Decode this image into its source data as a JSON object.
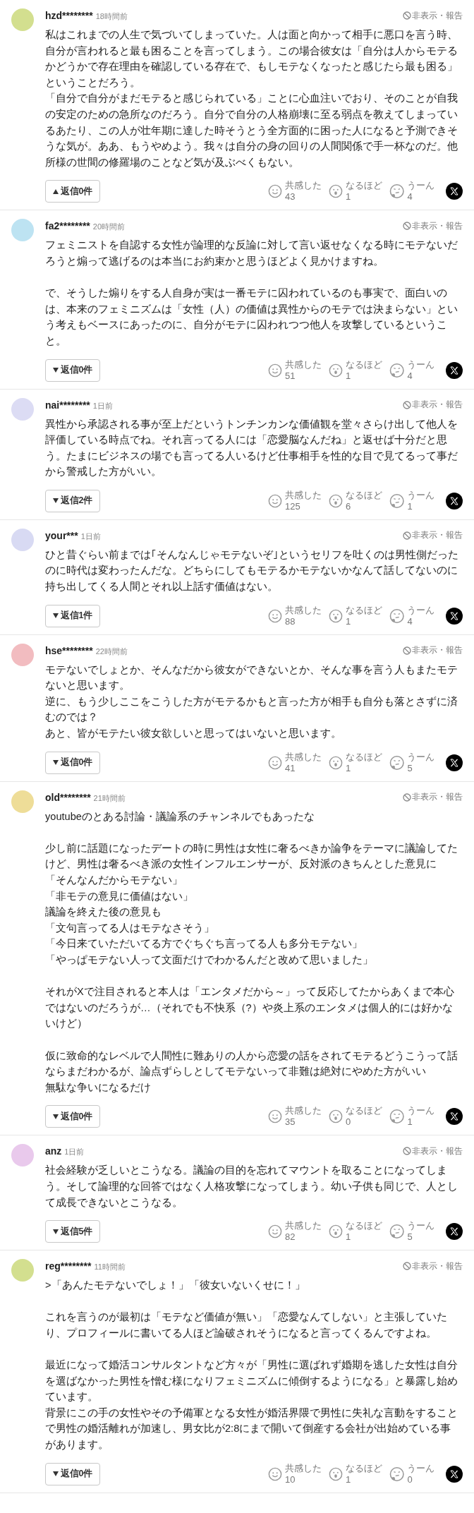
{
  "comments": [
    {
      "user": "hzd********",
      "time": "18時間前",
      "color": "#d3df8f",
      "hide_link": "非表示・報告",
      "paragraphs": [
        {
          "lines": [
            "私はこれまでの人生で気づいてしまっていた。人は面と向かって相手に悪口を言う時、自分が言われると最も困ることを言ってしまう。この場合彼女は「自分は人からモテるかどうかで存在理由を確認している存在で、もしモテなくなったと感じたら最も困る」ということだろう。",
            "「自分で自分がまだモテると感じられている」ことに心血注いでおり、そのことが自我の安定のための急所なのだろう。自分で自分の人格崩壊に至る弱点を教えてしまっているあたり、この人が壮年期に達した時そうとう全方面的に困った人になると予測できそうな気が。ああ、もうやめよう。我々は自分の身の回りの人間関係で手一杯なのだ。他所様の世間の修羅場のことなど気が及ぶべくもない。"
          ]
        }
      ],
      "replies": {
        "label": "返信0件",
        "expanded": true
      },
      "reactions": [
        {
          "kind": "empathy",
          "label": "共感した",
          "count": "43"
        },
        {
          "kind": "insight",
          "label": "なるほど",
          "count": "1"
        },
        {
          "kind": "hmm",
          "label": "うーん",
          "count": "4"
        }
      ]
    },
    {
      "user": "fa2********",
      "time": "20時間前",
      "color": "#bde3f2",
      "hide_link": "非表示・報告",
      "paragraphs": [
        {
          "lines": [
            "フェミニストを自認する女性が論理的な反論に対して言い返せなくなる時にモテないだろうと煽って逃げるのは本当にお約束かと思うほどよく見かけますね。"
          ]
        },
        {
          "lines": [
            "で、そうした煽りをする人自身が実は一番モテに囚われているのも事実で、面白いのは、本来のフェミニズムは「女性（人）の価値は異性からのモテでは決まらない」という考えもベースにあったのに、自分がモテに囚われつつ他人を攻撃しているということ。"
          ]
        }
      ],
      "replies": {
        "label": "返信0件",
        "expanded": false
      },
      "reactions": [
        {
          "kind": "empathy",
          "label": "共感した",
          "count": "51"
        },
        {
          "kind": "insight",
          "label": "なるほど",
          "count": "1"
        },
        {
          "kind": "hmm",
          "label": "うーん",
          "count": "4"
        }
      ]
    },
    {
      "user": "nai********",
      "time": "1日前",
      "color": "#dcdcf4",
      "hide_link": "非表示・報告",
      "paragraphs": [
        {
          "lines": [
            "異性から承認される事が至上だというトンチンカンな価値観を堂々さらけ出して他人を評価している時点でね。それ言ってる人には「恋愛脳なんだね」と返せば十分だと思う。たまにビジネスの場でも言ってる人いるけど仕事相手を性的な目で見てるって事だから警戒した方がいい。"
          ]
        }
      ],
      "replies": {
        "label": "返信2件",
        "expanded": false
      },
      "reactions": [
        {
          "kind": "empathy",
          "label": "共感した",
          "count": "125"
        },
        {
          "kind": "insight",
          "label": "なるほど",
          "count": "6"
        },
        {
          "kind": "hmm",
          "label": "うーん",
          "count": "1"
        }
      ]
    },
    {
      "user": "your***",
      "time": "1日前",
      "color": "#d8daf3",
      "hide_link": "非表示・報告",
      "paragraphs": [
        {
          "lines": [
            "ひと昔ぐらい前までは｢そんなんじゃモテないぞ｣というセリフを吐くのは男性側だったのに時代は変わったんだな。どちらにしてもモテるかモテないかなんて話してないのに持ち出してくる人間とそれ以上話す価値はない。"
          ]
        }
      ],
      "replies": {
        "label": "返信1件",
        "expanded": false
      },
      "reactions": [
        {
          "kind": "empathy",
          "label": "共感した",
          "count": "88"
        },
        {
          "kind": "insight",
          "label": "なるほど",
          "count": "1"
        },
        {
          "kind": "hmm",
          "label": "うーん",
          "count": "4"
        }
      ]
    },
    {
      "user": "hse********",
      "time": "22時間前",
      "color": "#f2bcc0",
      "hide_link": "非表示・報告",
      "paragraphs": [
        {
          "lines": [
            "モテないでしょとか、そんなだから彼女ができないとか、そんな事を言う人もまたモテないと思います。",
            "逆に、もう少しここをこうした方がモテるかもと言った方が相手も自分も落とさずに済むのでは？",
            "あと、皆がモテたい彼女欲しいと思ってはいないと思います。"
          ]
        }
      ],
      "replies": {
        "label": "返信0件",
        "expanded": false
      },
      "reactions": [
        {
          "kind": "empathy",
          "label": "共感した",
          "count": "41"
        },
        {
          "kind": "insight",
          "label": "なるほど",
          "count": "1"
        },
        {
          "kind": "hmm",
          "label": "うーん",
          "count": "5"
        }
      ]
    },
    {
      "user": "old********",
      "time": "21時間前",
      "color": "#eedd98",
      "hide_link": "非表示・報告",
      "paragraphs": [
        {
          "lines": [
            "youtubeのとある討論・議論系のチャンネルでもあったな"
          ]
        },
        {
          "lines": [
            "少し前に話題になったデートの時に男性は女性に奢るべきか論争をテーマに議論してたけど、男性は奢るべき派の女性インフルエンサーが、反対派のきちんとした意見に",
            "「そんなんだからモテない」",
            "「非モテの意見に価値はない」",
            "議論を終えた後の意見も",
            "「文句言ってる人はモテなさそう」",
            "「今日来ていただいてる方でぐちぐち言ってる人も多分モテない」",
            "「やっぱモテない人って文面だけでわかるんだと改めて思いました」"
          ]
        },
        {
          "lines": [
            "それがXで注目されると本人は「エンタメだから～」って反応してたからあくまで本心ではないのだろうが…（それでも不快系（?）や炎上系のエンタメは個人的には好かないけど）"
          ]
        },
        {
          "lines": [
            "仮に致命的なレベルで人間性に難ありの人から恋愛の話をされてモテるどうこうって話ならまだわかるが、論点ずらしとしてモテないって非難は絶対にやめた方がいい",
            "無駄な争いになるだけ"
          ]
        }
      ],
      "replies": {
        "label": "返信0件",
        "expanded": false
      },
      "reactions": [
        {
          "kind": "empathy",
          "label": "共感した",
          "count": "35"
        },
        {
          "kind": "insight",
          "label": "なるほど",
          "count": "0"
        },
        {
          "kind": "hmm",
          "label": "うーん",
          "count": "1"
        }
      ]
    },
    {
      "user": "anz",
      "time": "1日前",
      "color": "#e9c9ec",
      "hide_link": "非表示・報告",
      "paragraphs": [
        {
          "lines": [
            "社会経験が乏しいとこうなる。議論の目的を忘れてマウントを取ることになってしまう。そして論理的な回答ではなく人格攻撃になってしまう。幼い子供も同じで、人として成長できないとこうなる。"
          ]
        }
      ],
      "replies": {
        "label": "返信5件",
        "expanded": false
      },
      "reactions": [
        {
          "kind": "empathy",
          "label": "共感した",
          "count": "82"
        },
        {
          "kind": "insight",
          "label": "なるほど",
          "count": "1"
        },
        {
          "kind": "hmm",
          "label": "うーん",
          "count": "5"
        }
      ]
    },
    {
      "user": "reg********",
      "time": "11時間前",
      "color": "#d3df8f",
      "hide_link": "非表示・報告",
      "paragraphs": [
        {
          "lines": [
            ">「あんたモテないでしょ！」「彼女いないくせに！」"
          ]
        },
        {
          "lines": [
            "これを言うのが最初は「モテなど価値が無い」「恋愛なんてしない」と主張していたり、プロフィールに書いてる人ほど論破されそうになると言ってくるんですよね。"
          ]
        },
        {
          "lines": [
            "最近になって婚活コンサルタントなど方々が「男性に選ばれず婚期を逃した女性は自分を選ばなかった男性を憎む様になりフェミニズムに傾倒するようになる」と暴露し始めています。",
            "背景にこの手の女性やその予備軍となる女性が婚活界隈で男性に失礼な言動をすることで男性の婚活離れが加速し、男女比が2:8にまで開いて倒産する会社が出始めている事があります。"
          ]
        }
      ],
      "replies": {
        "label": "返信0件",
        "expanded": false
      },
      "reactions": [
        {
          "kind": "empathy",
          "label": "共感した",
          "count": "10"
        },
        {
          "kind": "insight",
          "label": "なるほど",
          "count": "1"
        },
        {
          "kind": "hmm",
          "label": "うーん",
          "count": "0"
        }
      ]
    }
  ]
}
